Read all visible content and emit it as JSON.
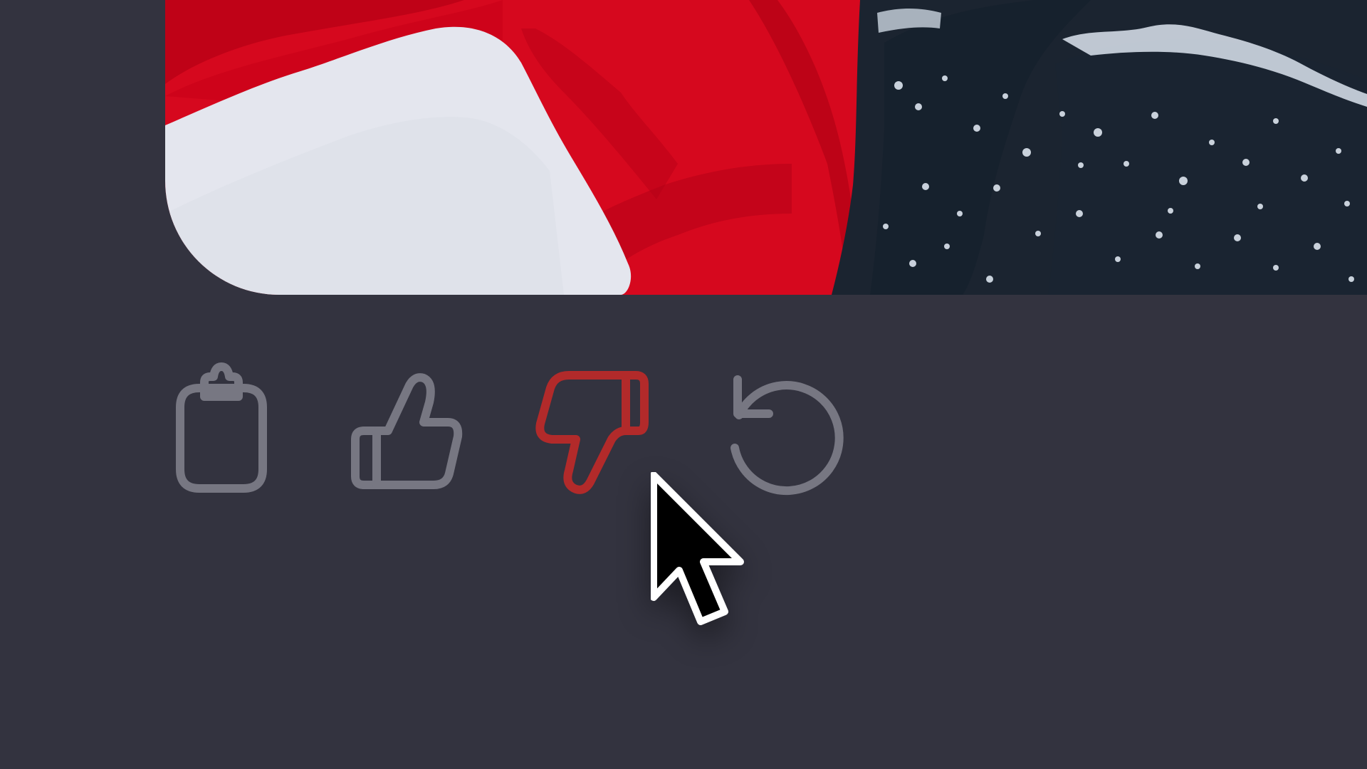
{
  "colors": {
    "background": "#33333F",
    "icon_default": "#777782",
    "icon_active": "#B22A2A",
    "image_red": "#D6081E",
    "image_white": "#E4E6EE",
    "image_dark": "#1B2430",
    "cursor_fill": "#000000",
    "cursor_stroke": "#FFFFFF"
  },
  "image": {
    "description_icon": "photo-icon"
  },
  "actions": [
    {
      "id": "copy",
      "icon": "clipboard-icon",
      "label": "Copy",
      "state": "default"
    },
    {
      "id": "like",
      "icon": "thumbs-up-icon",
      "label": "Good response",
      "state": "default"
    },
    {
      "id": "dislike",
      "icon": "thumbs-down-icon",
      "label": "Bad response",
      "state": "active"
    },
    {
      "id": "regenerate",
      "icon": "regenerate-icon",
      "label": "Regenerate",
      "state": "default"
    }
  ],
  "pointer": {
    "icon": "cursor-icon"
  }
}
